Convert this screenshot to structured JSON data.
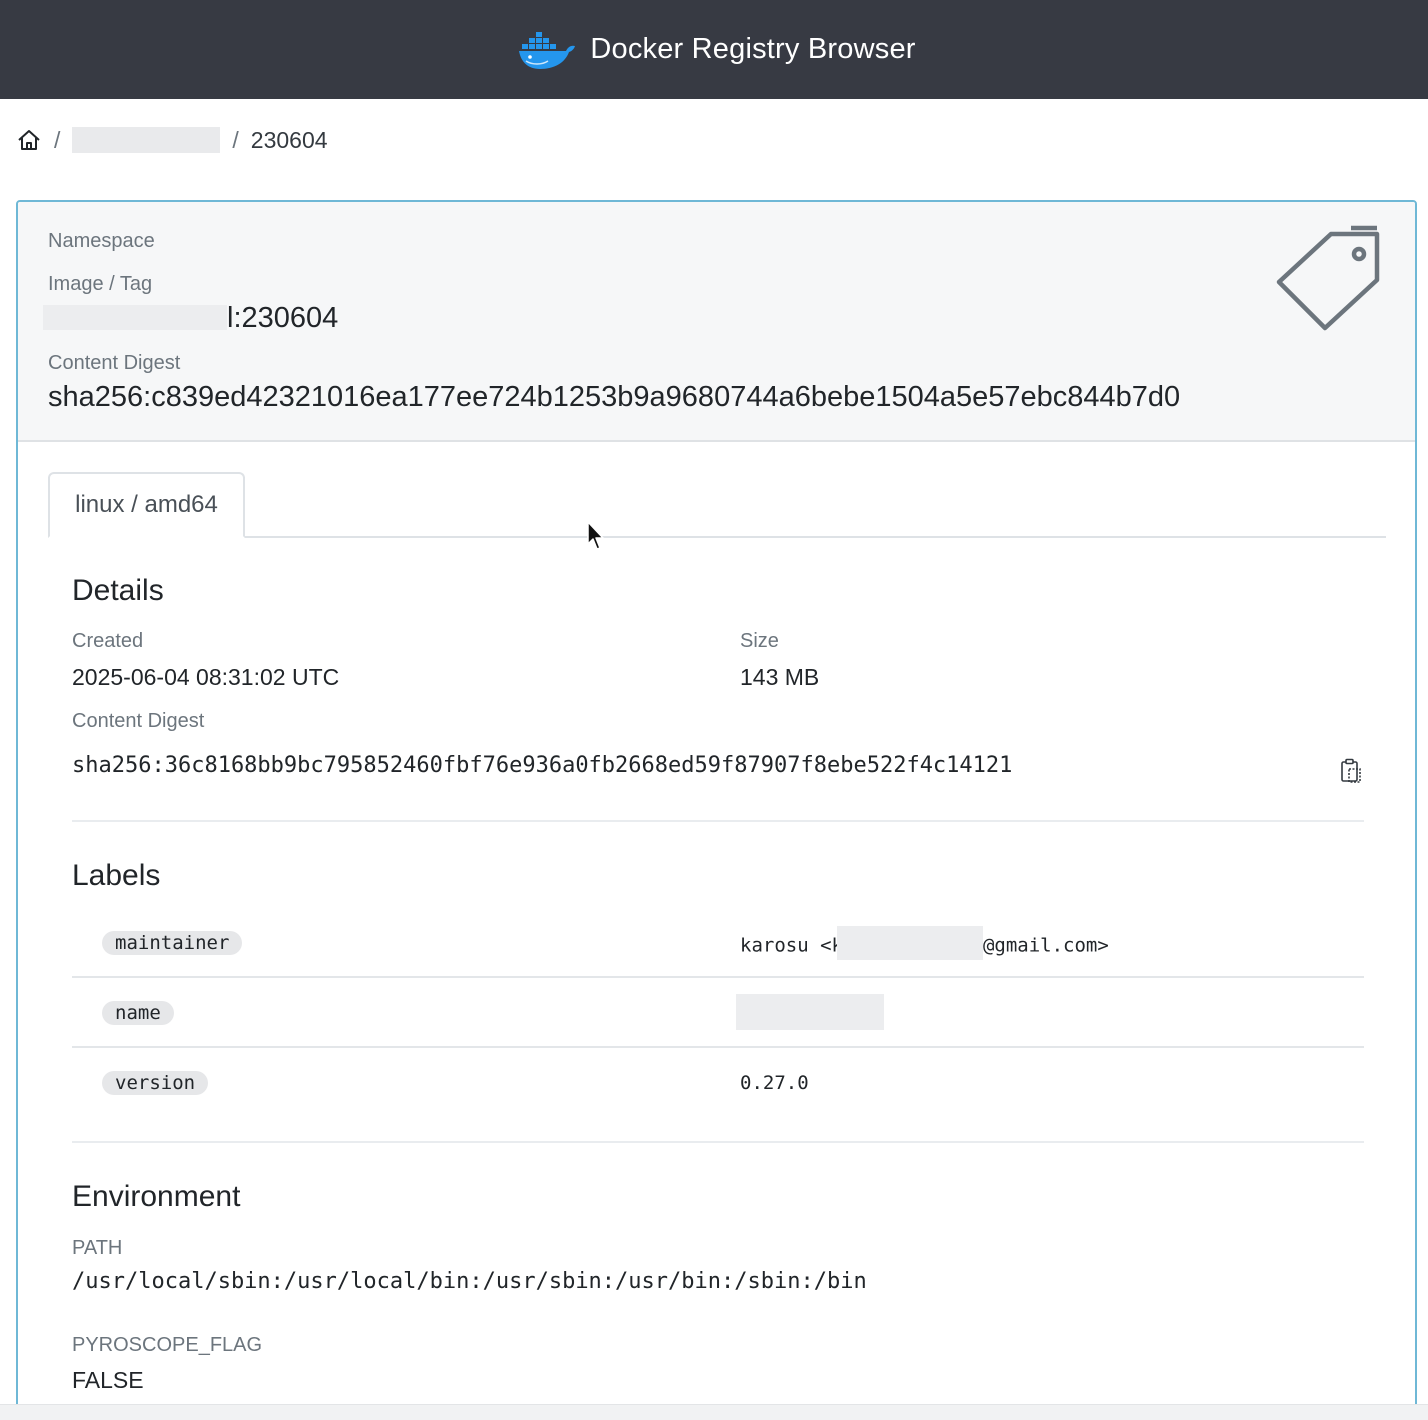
{
  "header": {
    "title": "Docker Registry Browser",
    "logo_icon": "docker-whale-icon"
  },
  "breadcrumb": {
    "home_icon": "home-icon",
    "separator": "/",
    "current": "230604"
  },
  "image": {
    "namespace_label": "Namespace",
    "image_tag_label": "Image / Tag",
    "image_tag_suffix": "l:230604",
    "content_digest_label": "Content Digest",
    "content_digest": "sha256:c839ed42321016ea177ee724b1253b9a9680744a6bebe1504a5e57ebc844b7d0",
    "tag_icon": "tag-icon"
  },
  "tabs": [
    {
      "label": "linux / amd64",
      "active": true
    }
  ],
  "details": {
    "title": "Details",
    "created_label": "Created",
    "created": "2025-06-04 08:31:02 UTC",
    "size_label": "Size",
    "size": "143 MB",
    "digest_label": "Content Digest",
    "digest": "sha256:36c8168bb9bc795852460fbf76e936a0fb2668ed59f87907f8ebe522f4c14121",
    "copy_icon": "clipboard-icon"
  },
  "labels": {
    "title": "Labels",
    "items": [
      {
        "key": "maintainer",
        "value_prefix": "karosu <k",
        "value_suffix": "@gmail.com>"
      },
      {
        "key": "name",
        "value": ""
      },
      {
        "key": "version",
        "value": "0.27.0"
      }
    ]
  },
  "environment": {
    "title": "Environment",
    "vars": [
      {
        "name": "PATH",
        "value": "/usr/local/sbin:/usr/local/bin:/usr/sbin:/usr/bin:/sbin:/bin"
      },
      {
        "name": "PYROSCOPE_FLAG",
        "value": "FALSE"
      }
    ]
  },
  "colors": {
    "header_bg": "#373a43",
    "card_border": "#6fb8d6",
    "docker_blue": "#2496ed"
  }
}
